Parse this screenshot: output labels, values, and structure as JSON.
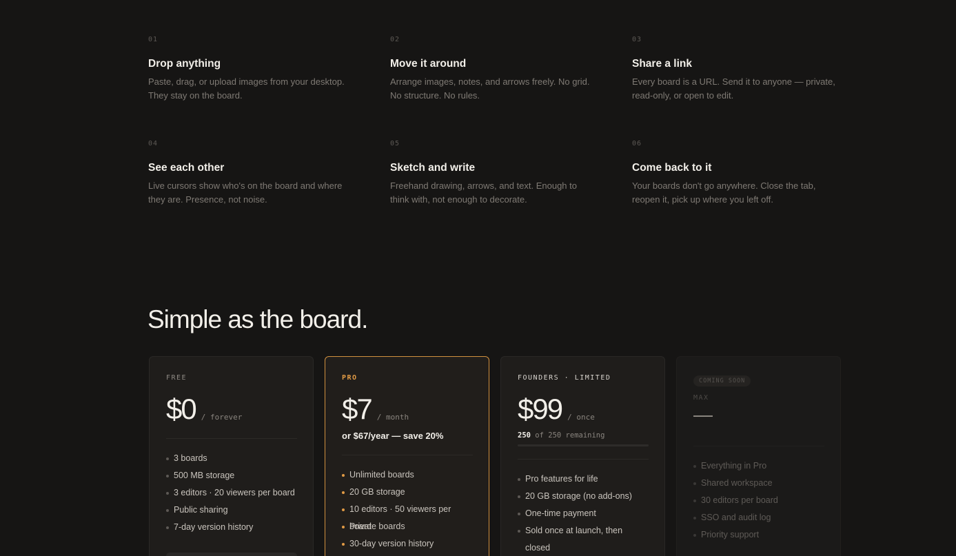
{
  "features": [
    {
      "num": "01",
      "title": "Drop anything",
      "desc": "Paste, drag, or upload images from your desktop. They stay on the board."
    },
    {
      "num": "02",
      "title": "Move it around",
      "desc": "Arrange images, notes, and arrows freely. No grid. No structure. No rules."
    },
    {
      "num": "03",
      "title": "Share a link",
      "desc": "Every board is a URL. Send it to anyone — private, read-only, or open to edit."
    },
    {
      "num": "04",
      "title": "See each other",
      "desc": "Live cursors show who's on the board and where they are. Presence, not noise."
    },
    {
      "num": "05",
      "title": "Sketch and write",
      "desc": "Freehand drawing, arrows, and text. Enough to think with, not enough to decorate."
    },
    {
      "num": "06",
      "title": "Come back to it",
      "desc": "Your boards don't go anywhere. Close the tab, reopen it, pick up where you left off."
    }
  ],
  "pricing": {
    "title": "Simple as the board.",
    "free": {
      "tier": "FREE",
      "price": "$0",
      "period": "/ forever",
      "items": [
        "3 boards",
        "500 MB storage",
        "3 editors · 20 viewers per board",
        "Public sharing",
        "7-day version history"
      ]
    },
    "pro": {
      "tier": "PRO",
      "price": "$7",
      "period": "/ month",
      "subline": "or $67/year — save 20%",
      "items": [
        "Unlimited boards",
        "20 GB storage",
        "10 editors · 50 viewers per board",
        "Private boards",
        "30-day version history"
      ]
    },
    "founders": {
      "tier": "FOUNDERS · LIMITED",
      "price": "$99",
      "period": "/ once",
      "remaining_count": "250",
      "remaining_text": "of 250 remaining",
      "remaining_fraction": 0,
      "items": [
        "Pro features for life",
        "20 GB storage (no add-ons)",
        "One-time payment",
        "Sold once at launch, then closed"
      ]
    },
    "max": {
      "badge": "COMING SOON",
      "tier": "MAX",
      "items": [
        "Everything in Pro",
        "Shared workspace",
        "30 editors per board",
        "SSO and audit log",
        "Priority support"
      ]
    }
  }
}
